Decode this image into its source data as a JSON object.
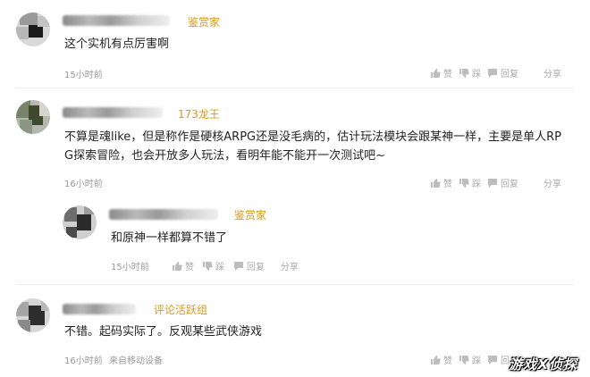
{
  "comments": [
    {
      "badge": "鉴赏家",
      "text": "这个实机有点厉害啊",
      "time": "15小时前",
      "actions": {
        "like": "赞",
        "dislike": "踩",
        "reply": "回复",
        "share": "分享"
      }
    },
    {
      "badge": "173龙王",
      "text_line1": "不算是魂like，但是称作是硬核ARPG还是没毛病的，估计玩法模块会跟某神一样，主要是单人RP",
      "text_line2": "G探索冒险，也会开放多人玩法，看明年能不能开一次测试吧~",
      "time": "16小时前",
      "actions": {
        "like": "赞",
        "dislike": "踩",
        "reply": "回复",
        "share": "分享"
      }
    },
    {
      "badge": "鉴赏家",
      "text": "和原神一样都算不错了",
      "time": "15小时前",
      "actions": {
        "like": "赞",
        "dislike": "踩",
        "reply": "回复",
        "share": "分享"
      }
    },
    {
      "badge": "评论活跃组",
      "text": "不错。起码实际了。反观某些武侠游戏",
      "time": "16小时前",
      "source": "来自移动设备",
      "actions": {
        "like": "赞",
        "dislike": "踩",
        "reply": "回复"
      }
    }
  ],
  "watermark": "游戏X侦探"
}
